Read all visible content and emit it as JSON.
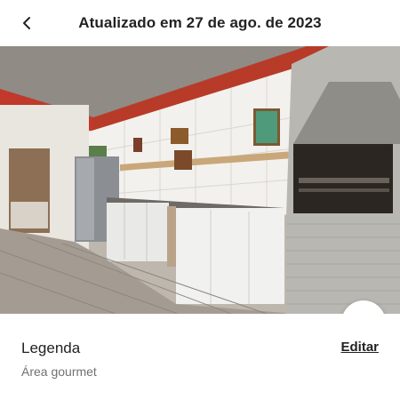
{
  "header": {
    "back_icon": "chevron-left-icon",
    "title": "Atualizado em 27 de ago. de 2023"
  },
  "photo": {
    "fab_icon": "pencil-icon"
  },
  "caption": {
    "label": "Legenda",
    "edit_label": "Editar",
    "value": "Área gourmet"
  }
}
